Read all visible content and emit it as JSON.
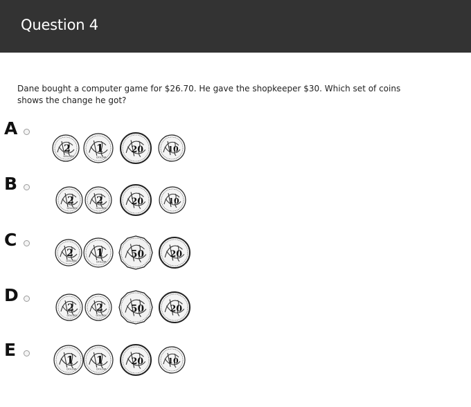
{
  "header": {
    "title": "Question 4"
  },
  "question": {
    "text": "Dane bought a computer game for $26.70. He gave the shopkeeper $30. Which set of coins shows the change he got?"
  },
  "options": [
    {
      "letter": "A",
      "coins": [
        {
          "type": "two-dollar",
          "numeral": "2",
          "word": "DOLLARS"
        },
        {
          "type": "one-dollar",
          "numeral": "1",
          "word": "DOLLAR"
        },
        {
          "type": "twenty-cent",
          "numeral": "20"
        },
        {
          "type": "ten-cent",
          "numeral": "10"
        }
      ]
    },
    {
      "letter": "B",
      "coins": [
        {
          "type": "two-dollar",
          "numeral": "2",
          "word": "DOLLARS"
        },
        {
          "type": "two-dollar",
          "numeral": "2",
          "word": "DOLLARS"
        },
        {
          "type": "twenty-cent",
          "numeral": "20"
        },
        {
          "type": "ten-cent",
          "numeral": "10"
        }
      ]
    },
    {
      "letter": "C",
      "coins": [
        {
          "type": "two-dollar",
          "numeral": "2",
          "word": "DOLLARS"
        },
        {
          "type": "one-dollar",
          "numeral": "1",
          "word": "DOLLAR"
        },
        {
          "type": "fifty-cent",
          "numeral": "50"
        },
        {
          "type": "twenty-cent",
          "numeral": "20"
        }
      ]
    },
    {
      "letter": "D",
      "coins": [
        {
          "type": "two-dollar",
          "numeral": "2",
          "word": "DOLLARS"
        },
        {
          "type": "two-dollar",
          "numeral": "2",
          "word": "DOLLARS"
        },
        {
          "type": "fifty-cent",
          "numeral": "50"
        },
        {
          "type": "twenty-cent",
          "numeral": "20"
        }
      ]
    },
    {
      "letter": "E",
      "coins": [
        {
          "type": "one-dollar",
          "numeral": "1",
          "word": "DOLLAR"
        },
        {
          "type": "one-dollar",
          "numeral": "1",
          "word": "DOLLAR"
        },
        {
          "type": "twenty-cent",
          "numeral": "20"
        },
        {
          "type": "ten-cent",
          "numeral": "10"
        }
      ]
    }
  ]
}
